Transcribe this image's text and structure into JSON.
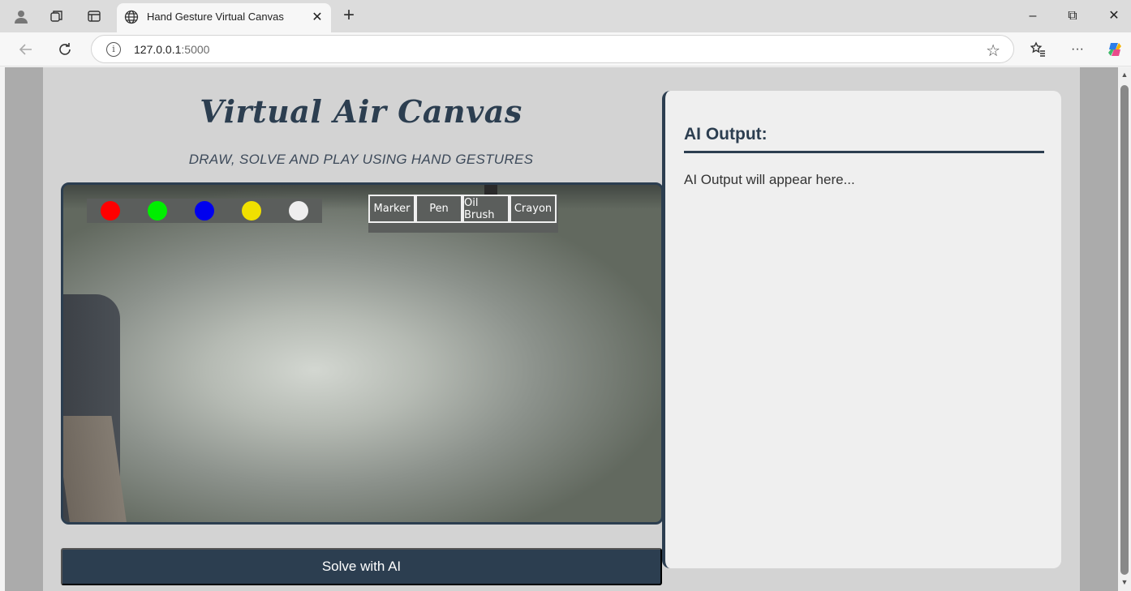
{
  "browser": {
    "tab_title": "Hand Gesture Virtual Canvas",
    "tab_close": "✕",
    "new_tab": "+",
    "url_host": "127.0.0.1",
    "url_port": ":5000",
    "info_icon": "i",
    "star_icon": "☆",
    "window": {
      "minimize": "–",
      "restore": "⧉",
      "close": "✕"
    },
    "more_icon": "···"
  },
  "app": {
    "title": "Virtual Air Canvas",
    "subtitle": "DRAW, SOLVE AND PLAY USING HAND GESTURES",
    "solve_button": "Solve with AI"
  },
  "palette": {
    "colors": [
      {
        "name": "red",
        "hex": "#ff0000"
      },
      {
        "name": "green",
        "hex": "#00ee00"
      },
      {
        "name": "blue",
        "hex": "#0000ee"
      },
      {
        "name": "yellow",
        "hex": "#f0e000"
      },
      {
        "name": "white",
        "hex": "#eeeeee"
      }
    ]
  },
  "tools": [
    "Marker",
    "Pen",
    "Oil Brush",
    "Crayon"
  ],
  "output": {
    "heading": "AI Output:",
    "placeholder": "AI Output will appear here..."
  },
  "theme": {
    "accent": "#2c3e50",
    "page_bg": "#d3d3d3",
    "panel_bg": "#efefef"
  }
}
